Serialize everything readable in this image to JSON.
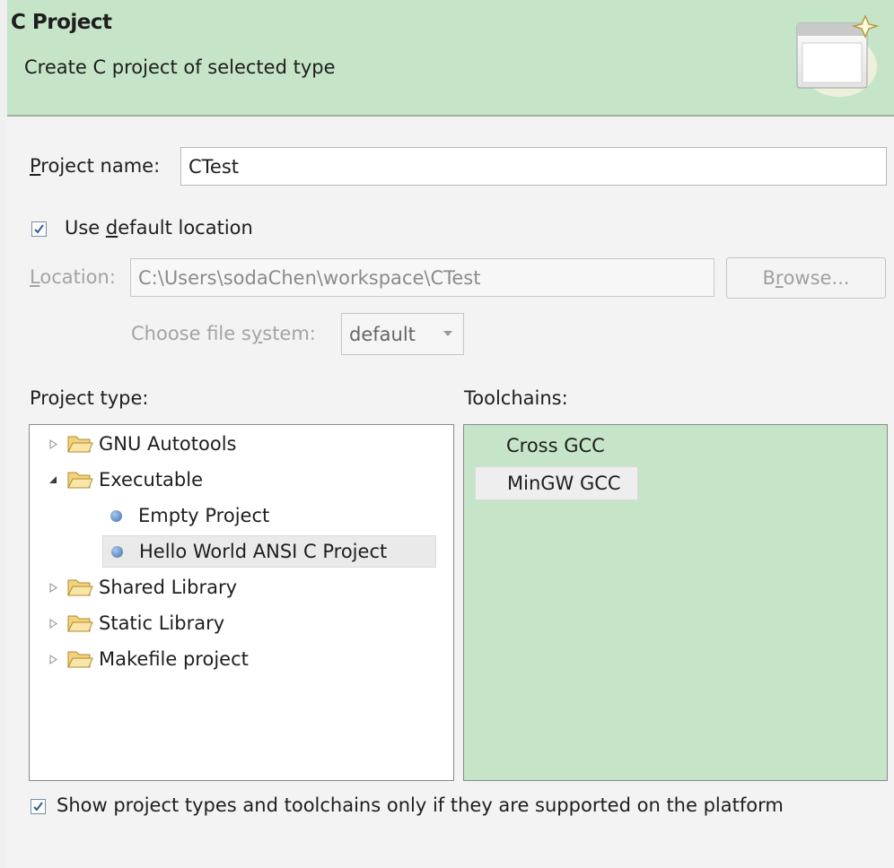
{
  "header": {
    "title": "C Project",
    "subtitle": "Create C project of selected type",
    "icon": "new-project-wizard-icon"
  },
  "project_name": {
    "label_first": "P",
    "label_rest": "roject name:",
    "value": "CTest"
  },
  "use_default": {
    "label_pre": "Use ",
    "label_u": "d",
    "label_post": "efault location",
    "checked": true
  },
  "location": {
    "label_u": "L",
    "label_rest": "ocation:",
    "value": "C:\\Users\\sodaChen\\workspace\\CTest",
    "browse_pre": "B",
    "browse_u": "r",
    "browse_post": "owse..."
  },
  "file_system": {
    "label_pre": "Choose file s",
    "label_u": "y",
    "label_post": "stem:",
    "value": "default"
  },
  "project_type": {
    "label": "Project type:",
    "items": [
      {
        "label": "GNU Autotools",
        "kind": "folder",
        "expanded": false
      },
      {
        "label": "Executable",
        "kind": "folder",
        "expanded": true
      },
      {
        "label": "Empty Project",
        "kind": "template"
      },
      {
        "label": "Hello World ANSI C Project",
        "kind": "template",
        "selected": true
      },
      {
        "label": "Shared Library",
        "kind": "folder",
        "expanded": false
      },
      {
        "label": "Static Library",
        "kind": "folder",
        "expanded": false
      },
      {
        "label": "Makefile project",
        "kind": "folder",
        "expanded": false
      }
    ]
  },
  "toolchains": {
    "label": "Toolchains:",
    "items": [
      {
        "label": "Cross GCC"
      },
      {
        "label": "MinGW GCC",
        "selected": true
      }
    ]
  },
  "show_supported": {
    "label": "Show project types and toolchains only if they are supported on the platform",
    "checked": true
  },
  "colors": {
    "header_bg": "#c6e4c8",
    "toolchain_bg": "#c6e4c8"
  }
}
